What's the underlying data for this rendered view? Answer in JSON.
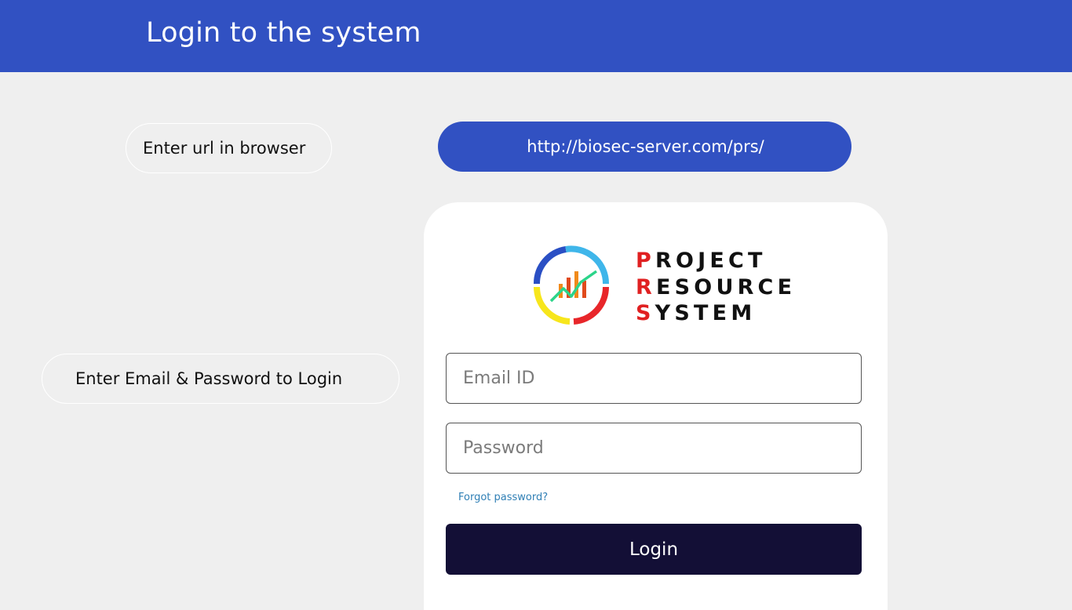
{
  "header": {
    "title": "Login to the system"
  },
  "steps": {
    "url_step": "Enter url in browser",
    "login_step": "Enter Email & Password to Login"
  },
  "url_bar": {
    "text": "http://biosec-server.com/prs/"
  },
  "brand": {
    "line1_initial": "P",
    "line1_rest": "ROJECT",
    "line2_initial": "R",
    "line2_rest": "ESOURCE",
    "line3_initial": "S",
    "line3_rest": "YSTEM",
    "logo_icon": "chart-ring-logo-icon"
  },
  "form": {
    "email_placeholder": "Email ID",
    "password_placeholder": "Password",
    "forgot_label": "Forgot password?",
    "login_label": "Login"
  },
  "colors": {
    "header_bg": "#3151c2",
    "login_button_bg": "#130f36",
    "brand_accent": "#e02021",
    "link": "#2f7fb5",
    "page_bg": "#efefef"
  }
}
